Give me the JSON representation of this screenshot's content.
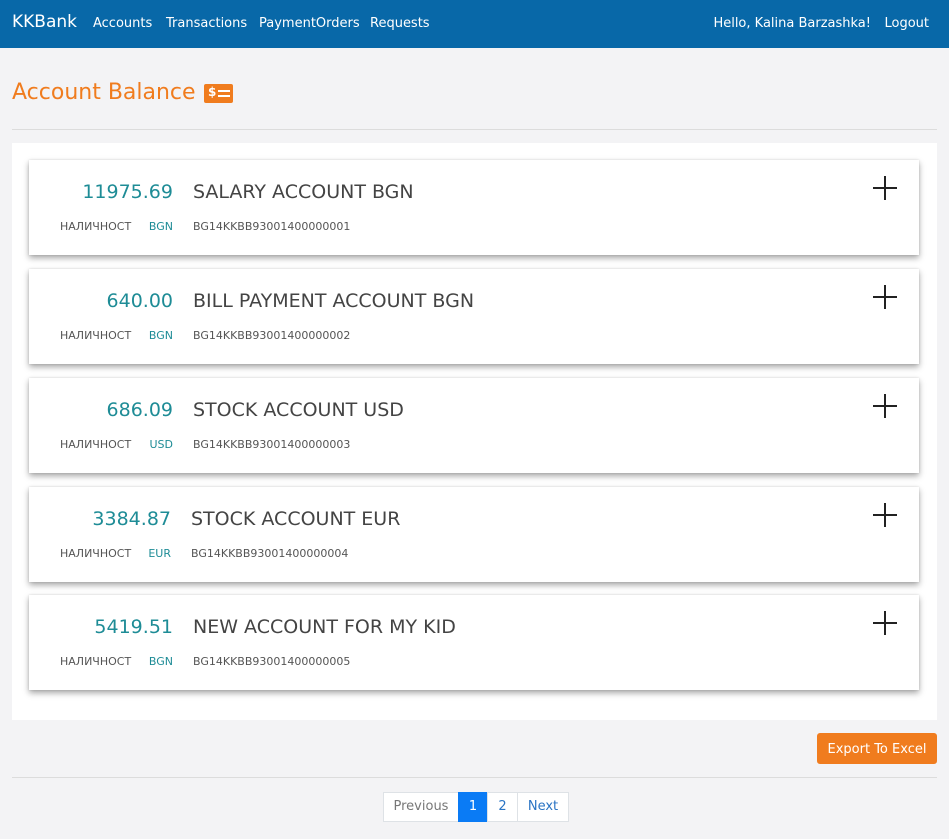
{
  "nav": {
    "brand": "KKBank",
    "links": [
      "Accounts",
      "Transactions",
      "PaymentOrders",
      "Requests"
    ],
    "greeting": "Hello, Kalina Barzashka!",
    "logout": "Logout"
  },
  "page": {
    "title": "Account Balance",
    "title_icon_text": "$"
  },
  "accounts": [
    {
      "amount": "11975.69",
      "name": "SALARY ACCOUNT BGN",
      "availability": "НАЛИЧНОСТ",
      "currency": "BGN",
      "iban": "BG14KKBB93001400000001"
    },
    {
      "amount": "640.00",
      "name": "BILL PAYMENT ACCOUNT BGN",
      "availability": "НАЛИЧНОСТ",
      "currency": "BGN",
      "iban": "BG14KKBB93001400000002"
    },
    {
      "amount": "686.09",
      "name": "STOCK ACCOUNT USD",
      "availability": "НАЛИЧНОСТ",
      "currency": "USD",
      "iban": "BG14KKBB93001400000003"
    },
    {
      "amount": "3384.87",
      "name": "STOCK ACCOUNT EUR",
      "availability": "НАЛИЧНОСТ",
      "currency": "EUR",
      "iban": "BG14KKBB93001400000004"
    },
    {
      "amount": "5419.51",
      "name": "NEW ACCOUNT FOR MY KID",
      "availability": "НАЛИЧНОСТ",
      "currency": "BGN",
      "iban": "BG14KKBB93001400000005"
    }
  ],
  "actions": {
    "export": "Export To Excel"
  },
  "pagination": {
    "previous": "Previous",
    "pages": [
      "1",
      "2"
    ],
    "current_page": "1",
    "next": "Next"
  },
  "colors": {
    "navbar": "#0868a8",
    "accent": "#f07c1e",
    "amount": "#1e8c96",
    "active_page": "#0a7bf5"
  }
}
